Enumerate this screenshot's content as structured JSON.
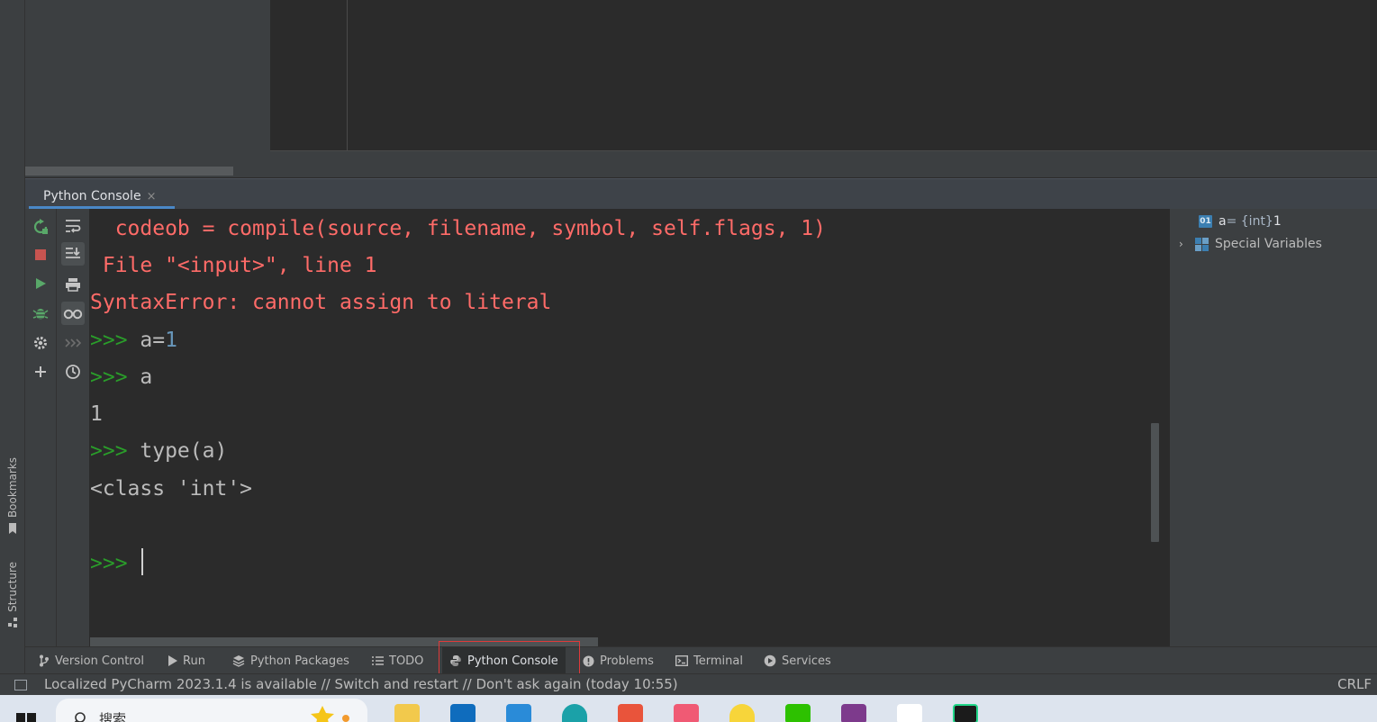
{
  "left_strip": {
    "bookmarks_label": "Bookmarks",
    "structure_label": "Structure"
  },
  "console_tab": {
    "title": "Python Console",
    "close_glyph": "×"
  },
  "console_lines": [
    {
      "segments": [
        {
          "t": "  codeob = compile(source, filename, symbol, self.flags, 1)",
          "c": "err"
        }
      ]
    },
    {
      "segments": [
        {
          "t": " File \"<input>\", line 1",
          "c": "err"
        }
      ]
    },
    {
      "segments": [
        {
          "t": "SyntaxError: cannot assign to literal",
          "c": "err"
        }
      ]
    },
    {
      "segments": [
        {
          "t": ">>> ",
          "c": "prompt"
        },
        {
          "t": "a=",
          "c": "norm"
        },
        {
          "t": "1",
          "c": "num"
        }
      ]
    },
    {
      "segments": [
        {
          "t": ">>> ",
          "c": "prompt"
        },
        {
          "t": "a",
          "c": "norm"
        }
      ]
    },
    {
      "segments": [
        {
          "t": "1",
          "c": "norm"
        }
      ]
    },
    {
      "segments": [
        {
          "t": ">>> ",
          "c": "prompt"
        },
        {
          "t": "type(a)",
          "c": "norm"
        }
      ]
    },
    {
      "segments": [
        {
          "t": "<class 'int'>",
          "c": "norm"
        }
      ]
    }
  ],
  "input_prompt": ">>> ",
  "variables": {
    "var_a": {
      "badge": "01",
      "name": "a",
      "type": " = {int} ",
      "value": "1"
    },
    "special_label": "Special Variables",
    "expand_glyph": "›"
  },
  "tool_windows": [
    {
      "label": "Version Control",
      "icon": "branch-icon"
    },
    {
      "label": "Run",
      "icon": "play-icon"
    },
    {
      "label": "Python Packages",
      "icon": "layers-icon"
    },
    {
      "label": "TODO",
      "icon": "list-icon"
    },
    {
      "label": "Python Console",
      "icon": "python-icon",
      "active": true
    },
    {
      "label": "Problems",
      "icon": "alert-icon"
    },
    {
      "label": "Terminal",
      "icon": "terminal-icon"
    },
    {
      "label": "Services",
      "icon": "services-icon"
    }
  ],
  "status": {
    "message": "Localized PyCharm 2023.1.4 is available // Switch and restart // Don't ask again (today 10:55)",
    "line_ending": "CRLF"
  },
  "taskbar": {
    "search_text": "搜索"
  },
  "colors": {
    "error": "#ff6b68",
    "prompt": "#2a9d2a",
    "number": "#6897bb",
    "accent": "#4a88c7",
    "highlight": "#e03a3a"
  }
}
